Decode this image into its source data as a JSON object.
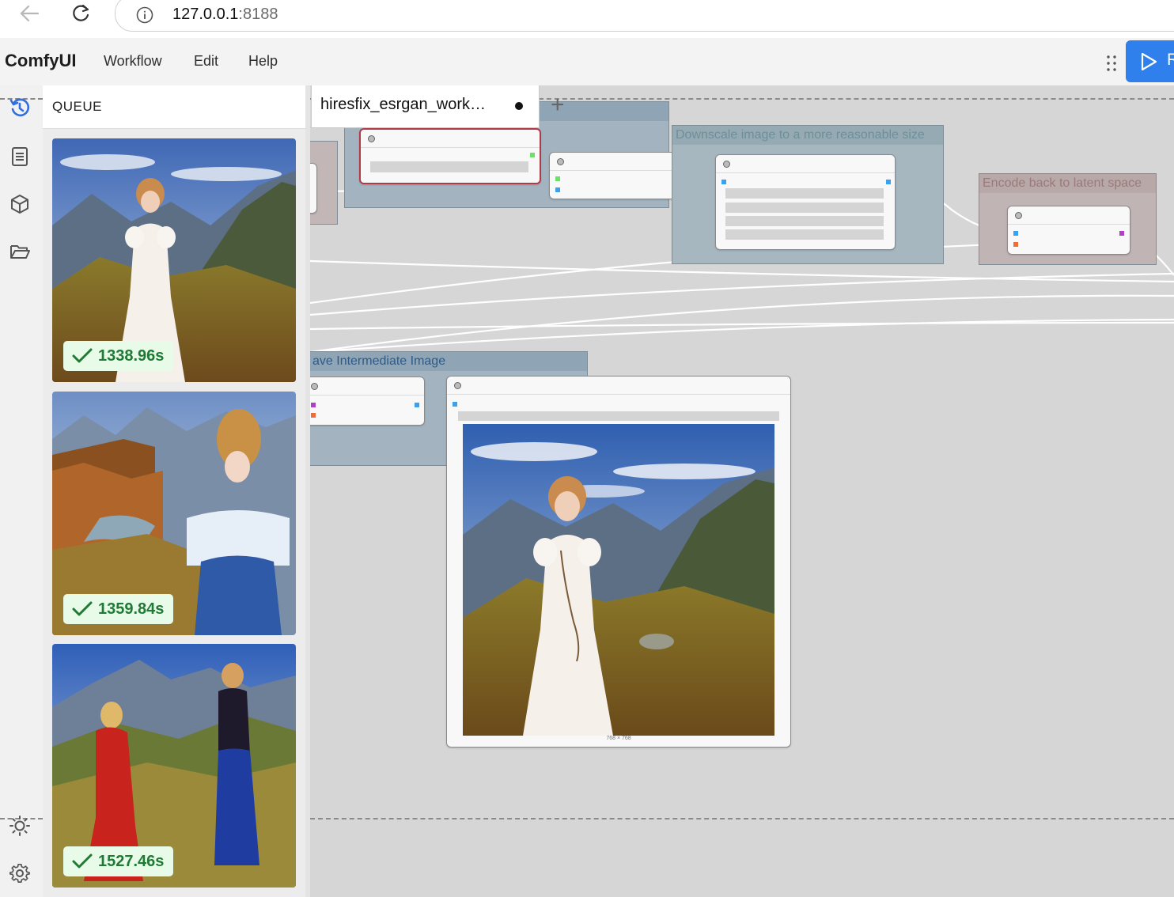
{
  "browser": {
    "url_host": "127.0.0.1",
    "url_port": ":8188"
  },
  "app": {
    "logo": "ComfyUI",
    "menu": [
      "Workflow",
      "Edit",
      "Help"
    ],
    "run_label": "R",
    "accent": "#2f80ed"
  },
  "rail": {
    "icons": [
      "history-icon",
      "document-icon",
      "cube-icon",
      "folder-icon",
      "sun-icon",
      "gear-icon"
    ]
  },
  "queue": {
    "title": "QUEUE",
    "items": [
      {
        "time": "1338.96s"
      },
      {
        "time": "1359.84s"
      },
      {
        "time": "1527.46s"
      }
    ],
    "badge_color": "#1f7a34"
  },
  "workflow": {
    "tab_label": "hiresfix_esrgan_work…",
    "groups": {
      "downscale": "Downscale image to a more reasonable size",
      "encode": "Encode back to latent space",
      "save": "ave Intermediate Image"
    },
    "preview_caption": "768 × 768"
  }
}
